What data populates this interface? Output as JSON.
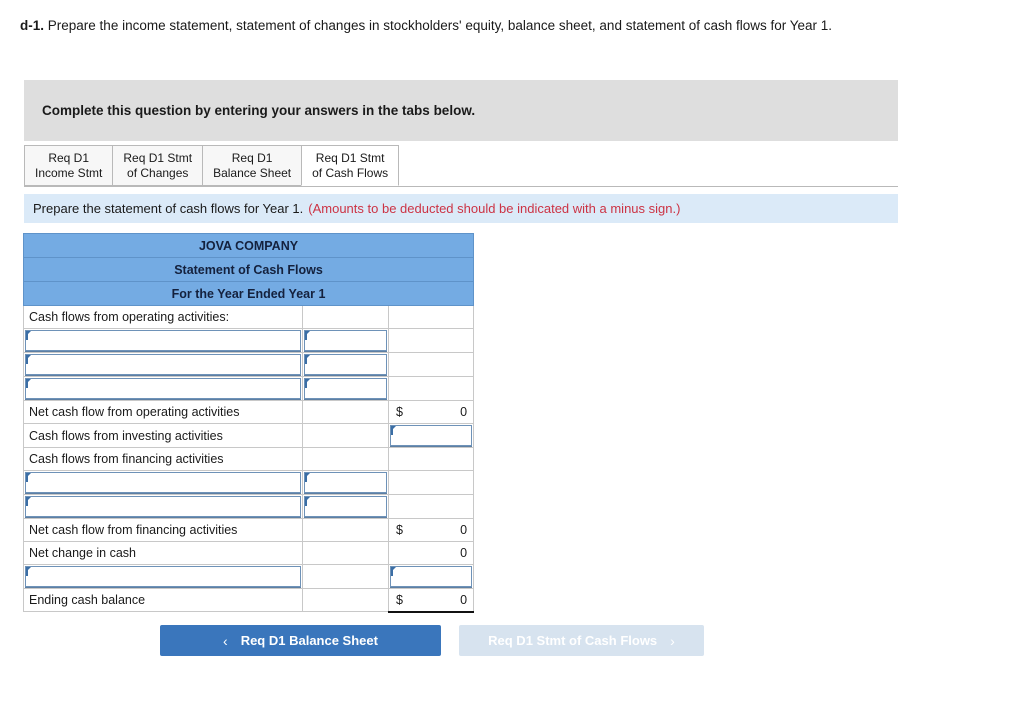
{
  "prompt": {
    "label": "d-1.",
    "text": "Prepare the income statement, statement of changes in stockholders' equity, balance sheet, and statement of cash flows for Year 1."
  },
  "gray_banner": {
    "text": "Complete this question by entering your answers in the tabs below."
  },
  "tabs": [
    {
      "line1": "Req D1",
      "line2": "Income Stmt"
    },
    {
      "line1": "Req D1 Stmt",
      "line2": "of Changes"
    },
    {
      "line1": "Req D1",
      "line2": "Balance Sheet"
    },
    {
      "line1": "Req D1 Stmt",
      "line2": "of Cash Flows"
    }
  ],
  "instruction": {
    "main": "Prepare the statement of cash flows for Year 1.",
    "note": "(Amounts to be deducted should be indicated with a minus sign.)"
  },
  "statement": {
    "company": "JOVA COMPANY",
    "title": "Statement of Cash Flows",
    "period": "For the Year Ended Year 1",
    "rows": [
      {
        "type": "label",
        "label": "Cash flows from operating activities:"
      },
      {
        "type": "input_pair"
      },
      {
        "type": "input_pair"
      },
      {
        "type": "input_pair"
      },
      {
        "type": "total",
        "label": "Net cash flow from operating activities",
        "dollar": "$",
        "value": "0"
      },
      {
        "type": "label_input3",
        "label": "Cash flows from investing activities"
      },
      {
        "type": "label",
        "label": "Cash flows from financing activities"
      },
      {
        "type": "input_pair"
      },
      {
        "type": "input_pair"
      },
      {
        "type": "total",
        "label": "Net cash flow from financing activities",
        "dollar": "$",
        "value": "0"
      },
      {
        "type": "total",
        "label": "Net change in cash",
        "dollar": "",
        "value": "0"
      },
      {
        "type": "input_label_and_3"
      },
      {
        "type": "total_ruled",
        "label": "Ending cash balance",
        "dollar": "$",
        "value": "0"
      }
    ]
  },
  "nav": {
    "prev_label": "Req D1 Balance Sheet",
    "prev_chevron": "‹",
    "next_label": "Req D1 Stmt of Cash Flows",
    "next_chevron": "›"
  },
  "colors": {
    "header_blue": "#74abe3",
    "strip_blue": "#dbeaf8",
    "banner_gray": "#dedede",
    "button_blue": "#3a76bc",
    "button_disabled": "#d7e3ef",
    "note_red": "#cc3344"
  }
}
